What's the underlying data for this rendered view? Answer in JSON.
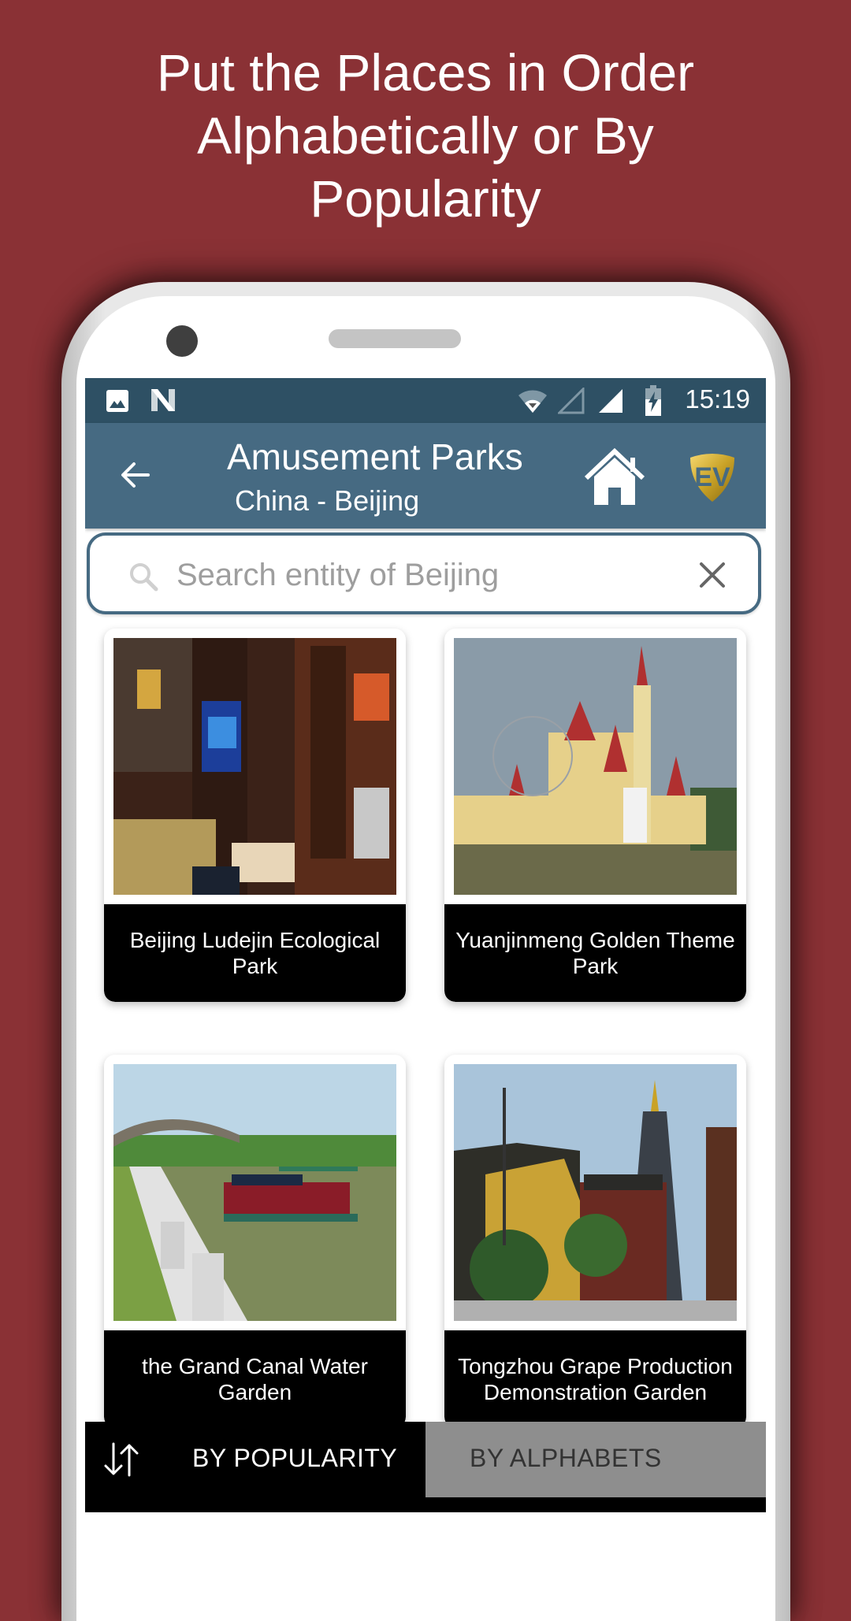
{
  "promo": {
    "line1": "Put the Places in Order",
    "line2": "Alphabetically or By",
    "line3": "Popularity"
  },
  "statusbar": {
    "left_icons": [
      "image-icon",
      "n-logo-icon"
    ],
    "right_icons": [
      "wifi-icon",
      "signal-empty-icon",
      "signal-full-icon",
      "battery-charging-icon"
    ],
    "time": "15:19"
  },
  "appbar": {
    "title": "Amusement Parks",
    "subtitle": "China - Beijing",
    "back_icon": "arrow-left-icon",
    "home_icon": "home-icon",
    "logo_text": "EV"
  },
  "search": {
    "placeholder": "Search entity of Beijing",
    "value": ""
  },
  "places": [
    {
      "name": "Beijing Ludejin Ecological Park",
      "image": "hotel-room-photo"
    },
    {
      "name": "Yuanjinmeng Golden Theme Park",
      "image": "castle-photo"
    },
    {
      "name": "the Grand Canal Water Garden",
      "image": "canal-boat-photo"
    },
    {
      "name": "Tongzhou Grape Production Demonstration Garden",
      "image": "pagoda-photo"
    }
  ],
  "sort_tabs": {
    "popularity": "BY POPULARITY",
    "alphabets": "BY ALPHABETS",
    "active": "popularity"
  },
  "colors": {
    "background": "#8a3135",
    "statusbar": "#2e5064",
    "appbar": "#466a82",
    "inactive_tab": "#8e8e8e"
  }
}
